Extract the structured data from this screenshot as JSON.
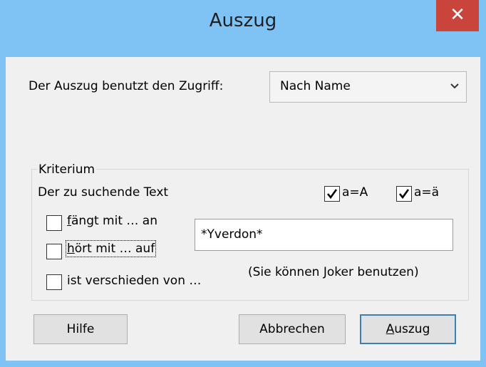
{
  "window": {
    "title": "Auszug",
    "close_symbol": "✕"
  },
  "access": {
    "label": "Der Auszug benutzt den Zugriff:",
    "selected": "Nach Name"
  },
  "criterion": {
    "caption": "Kriterium",
    "search_text_label": "Der zu suchende Text",
    "case_option": {
      "label": "a=A",
      "checked": true
    },
    "accent_option": {
      "label": "a=ä",
      "checked": true
    },
    "starts_with": {
      "mnemonic": "f",
      "rest": "ängt mit … an",
      "checked": false
    },
    "ends_with": {
      "mnemonic": "h",
      "rest": "ört mit … auf",
      "checked": false
    },
    "differs_from": {
      "label": "ist verschieden von …",
      "checked": false
    },
    "search_value": "*Yverdon*",
    "hint": "(Sie können Joker benutzen)"
  },
  "buttons": {
    "help": "Hilfe",
    "cancel": "Abbrechen",
    "extract_mnemonic": "A",
    "extract_rest": "uszug"
  },
  "colors": {
    "frame": "#7fc3f5",
    "close_button": "#c9443a",
    "client_background": "#f0f0f0",
    "default_button_border": "#3c7fb1"
  }
}
